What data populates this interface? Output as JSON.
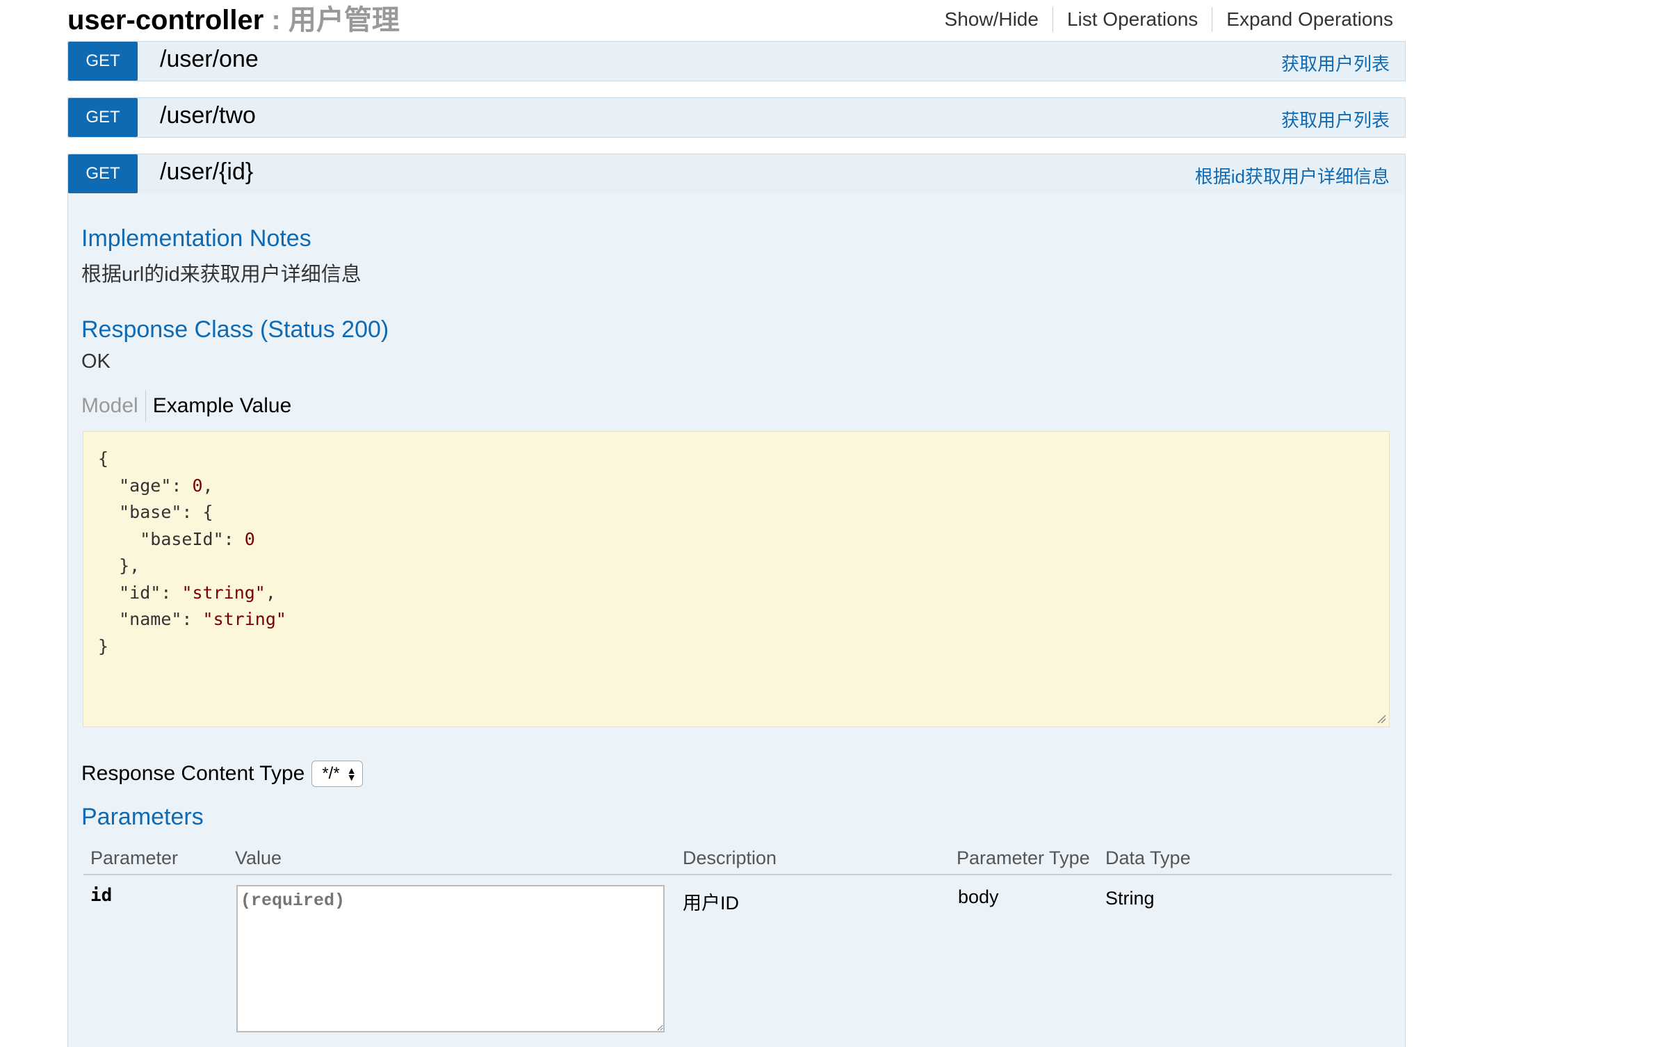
{
  "section": {
    "name": "user-controller",
    "separator": " : ",
    "description": "用户管理"
  },
  "header_links": {
    "show_hide": "Show/Hide",
    "list_operations": "List Operations",
    "expand_operations": "Expand Operations"
  },
  "operations": [
    {
      "method": "GET",
      "path": "/user/one",
      "summary": "获取用户列表"
    },
    {
      "method": "GET",
      "path": "/user/two",
      "summary": "获取用户列表"
    },
    {
      "method": "GET",
      "path": "/user/{id}",
      "summary": "根据id获取用户详细信息"
    }
  ],
  "expanded": {
    "implementation_notes_title": "Implementation Notes",
    "implementation_notes": "根据url的id来获取用户详细信息",
    "response_class_title": "Response Class (Status 200)",
    "response_class_text": "OK",
    "tabs": {
      "model": "Model",
      "example_value": "Example Value"
    },
    "example_json": {
      "open": "{",
      "age_key": "\"age\"",
      "age_val": "0",
      "base_key": "\"base\"",
      "base_open": "{",
      "baseId_key": "\"baseId\"",
      "baseId_val": "0",
      "base_close": "},",
      "id_key": "\"id\"",
      "id_val": "\"string\"",
      "name_key": "\"name\"",
      "name_val": "\"string\"",
      "close": "}"
    },
    "response_content_type_label": "Response Content Type",
    "response_content_type_value": "*/*",
    "parameters_title": "Parameters",
    "parameters_headers": [
      "Parameter",
      "Value",
      "Description",
      "Parameter Type",
      "Data Type"
    ],
    "parameters": [
      {
        "name": "id",
        "placeholder": "(required)",
        "description": "用户ID",
        "param_type": "body",
        "data_type": "String"
      }
    ]
  },
  "colors": {
    "method_get": "#0f6ab4",
    "op_bg": "#e7f0f7",
    "content_bg": "#ebf3f9",
    "code_bg": "#fcf6db",
    "link_blue": "#0f6ab4"
  }
}
